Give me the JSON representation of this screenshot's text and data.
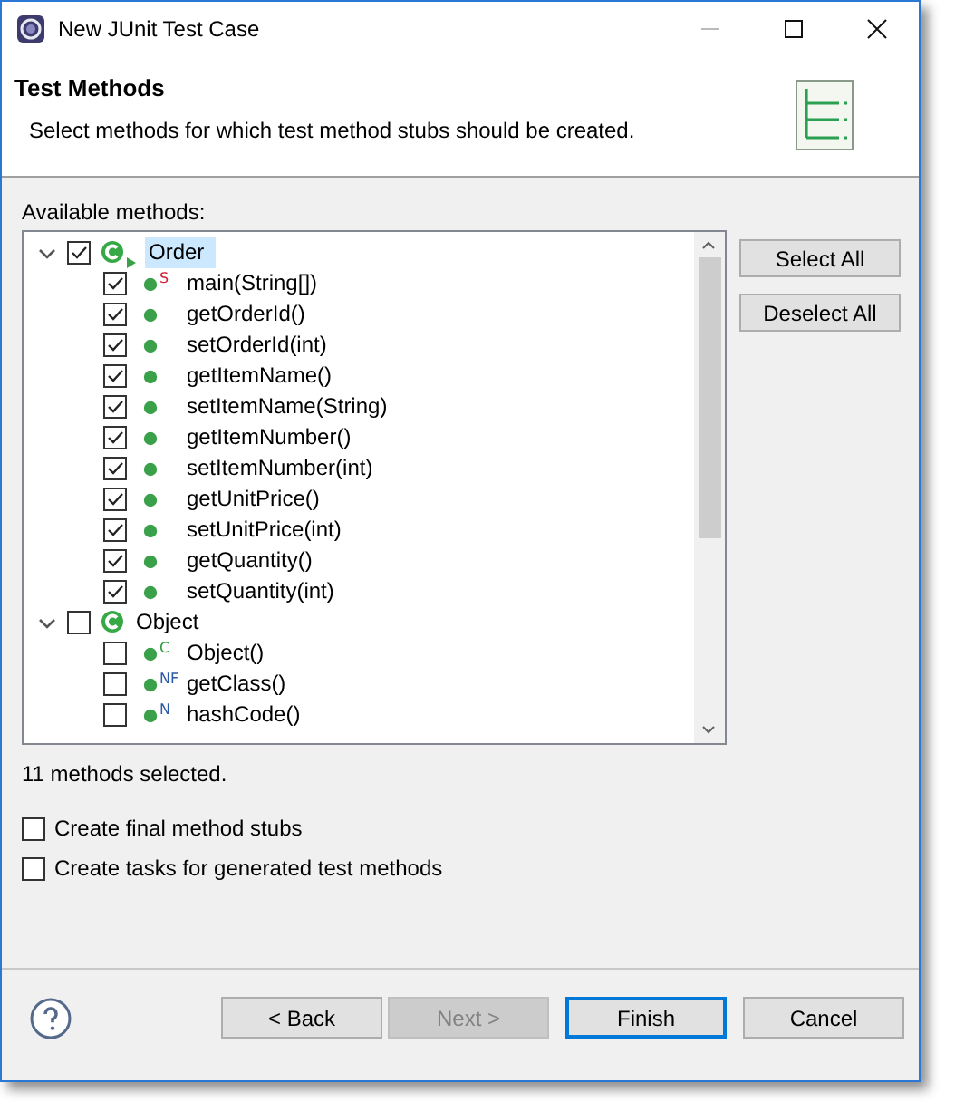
{
  "window": {
    "title": "New JUnit Test Case"
  },
  "header": {
    "title": "Test Methods",
    "description": "Select methods for which test method stubs should be created."
  },
  "methods": {
    "label": "Available methods:",
    "tree": [
      {
        "kind": "class",
        "label": "Order",
        "checked": true,
        "expanded": true,
        "selected": true,
        "runnable": true,
        "children": [
          {
            "kind": "method",
            "label": "main(String[])",
            "badge": "S",
            "color": "#d0203a",
            "checked": true,
            "selected": false
          },
          {
            "kind": "method",
            "label": "getOrderId()",
            "checked": true,
            "selected": false
          },
          {
            "kind": "method",
            "label": "setOrderId(int)",
            "checked": true,
            "selected": false
          },
          {
            "kind": "method",
            "label": "getItemName()",
            "checked": true,
            "selected": false
          },
          {
            "kind": "method",
            "label": "setItemName(String)",
            "checked": true,
            "selected": false
          },
          {
            "kind": "method",
            "label": "getItemNumber()",
            "checked": true,
            "selected": false
          },
          {
            "kind": "method",
            "label": "setItemNumber(int)",
            "checked": true,
            "selected": false
          },
          {
            "kind": "method",
            "label": "getUnitPrice()",
            "checked": true,
            "selected": false
          },
          {
            "kind": "method",
            "label": "setUnitPrice(int)",
            "checked": true,
            "selected": false
          },
          {
            "kind": "method",
            "label": "getQuantity()",
            "checked": true,
            "selected": false
          },
          {
            "kind": "method",
            "label": "setQuantity(int)",
            "checked": true,
            "selected": false
          }
        ]
      },
      {
        "kind": "class",
        "label": "Object",
        "checked": false,
        "expanded": true,
        "selected": false,
        "runnable": false,
        "children": [
          {
            "kind": "method",
            "label": "Object()",
            "badge": "C",
            "color": "#2a9a3a",
            "checked": false,
            "selected": false
          },
          {
            "kind": "method",
            "label": "getClass()",
            "badge": "NF",
            "color": "#2d5aa8",
            "checked": false,
            "selected": false
          },
          {
            "kind": "method",
            "label": "hashCode()",
            "badge": "N",
            "color": "#2d5aa8",
            "checked": false,
            "selected": false
          }
        ]
      }
    ]
  },
  "side_buttons": [
    "Select All",
    "Deselect All"
  ],
  "status": "11 methods selected.",
  "options": [
    {
      "label": "Create final method stubs",
      "checked": false
    },
    {
      "label": "Create tasks for generated test methods",
      "checked": false
    }
  ],
  "buttons": [
    {
      "label": "< Back",
      "disabled": false,
      "default": false
    },
    {
      "label": "Next >",
      "disabled": true,
      "default": false
    },
    {
      "label": "Finish",
      "disabled": false,
      "default": true
    },
    {
      "label": "Cancel",
      "disabled": false,
      "default": false
    }
  ]
}
